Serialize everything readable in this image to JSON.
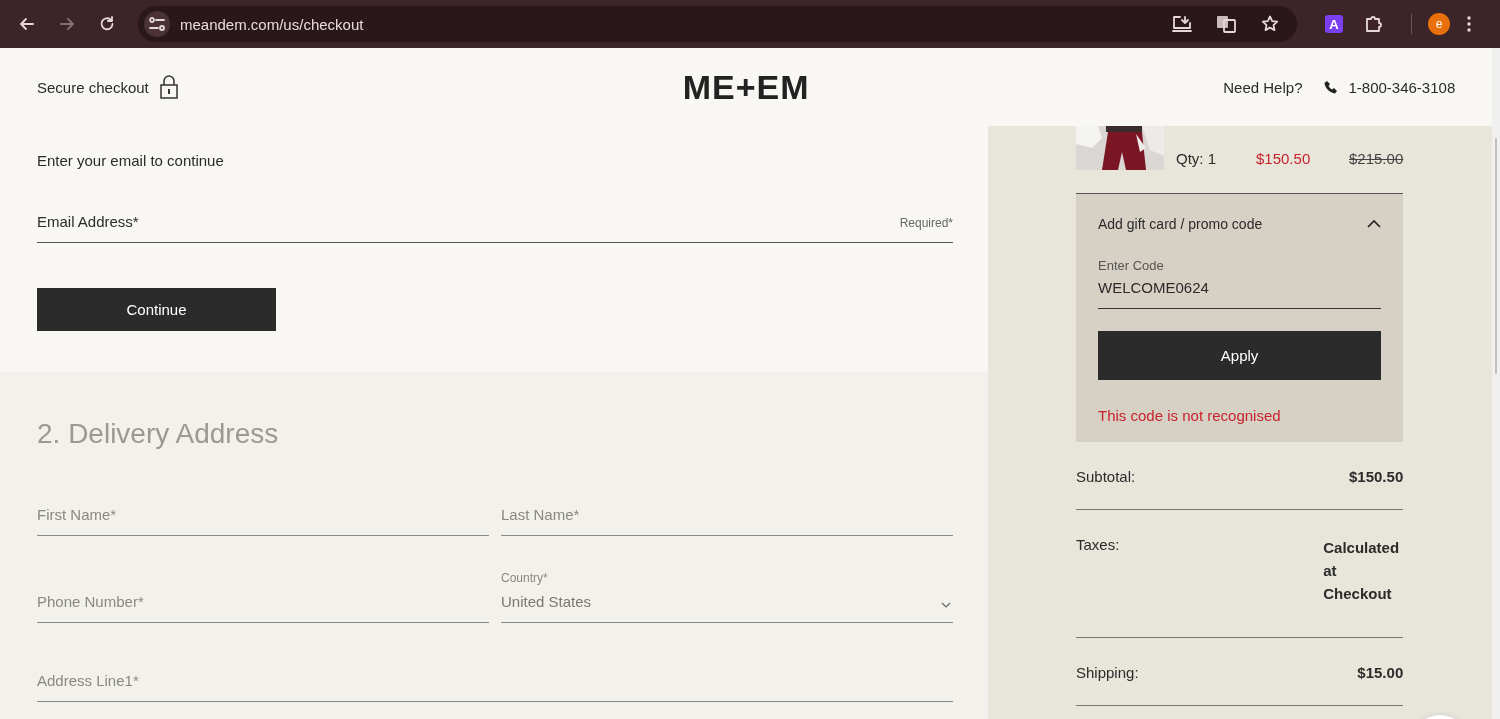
{
  "browser": {
    "url": "meandem.com/us/checkout",
    "extension_letter": "A",
    "profile_initial": "e"
  },
  "header": {
    "secure_label": "Secure checkout",
    "logo": "ME+EM",
    "help": "Need Help?",
    "phone": "1-800-346-3108"
  },
  "email_step": {
    "prompt": "Enter your email to continue",
    "email_label": "Email Address*",
    "email_hint": "Required*",
    "continue_button": "Continue"
  },
  "delivery": {
    "heading": "2. Delivery Address",
    "rows": [
      [
        {
          "kind": "text",
          "placeholder": "First Name*"
        },
        {
          "kind": "text",
          "placeholder": "Last Name*"
        }
      ],
      [
        {
          "kind": "text",
          "placeholder": "Phone Number*"
        },
        {
          "kind": "select",
          "label": "Country*",
          "value": "United States"
        }
      ],
      [
        {
          "kind": "text",
          "placeholder": "Address Line1*"
        }
      ]
    ]
  },
  "summary": {
    "item": {
      "qty": "Qty: 1",
      "price": "$150.50",
      "original_price": "$215.00"
    },
    "promo": {
      "title": "Add gift card / promo code",
      "expanded": true,
      "code_label": "Enter Code",
      "code_value": "WELCOME0624",
      "apply_button": "Apply",
      "error": "This code is not recognised"
    },
    "totals": [
      {
        "label": "Subtotal:",
        "value": "$150.50"
      },
      {
        "label": "Taxes:",
        "value": "Calculated at Checkout"
      },
      {
        "label": "Shipping:",
        "value": "$15.00"
      }
    ]
  }
}
